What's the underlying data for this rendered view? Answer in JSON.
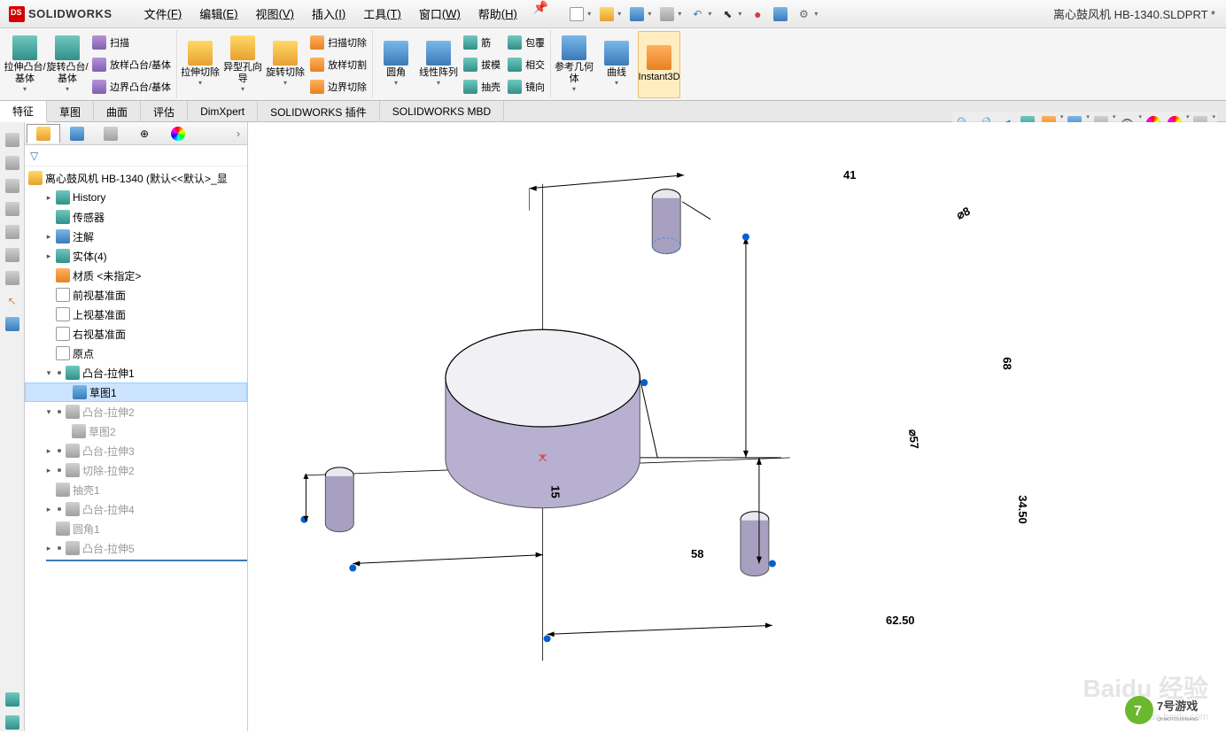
{
  "app": {
    "name": "SOLIDWORKS"
  },
  "document": {
    "title": "离心鼓风机 HB-1340.SLDPRT *"
  },
  "menu": [
    {
      "label": "文件",
      "hotkey": "(F)"
    },
    {
      "label": "编辑",
      "hotkey": "(E)"
    },
    {
      "label": "视图",
      "hotkey": "(V)"
    },
    {
      "label": "插入",
      "hotkey": "(I)"
    },
    {
      "label": "工具",
      "hotkey": "(T)"
    },
    {
      "label": "窗口",
      "hotkey": "(W)"
    },
    {
      "label": "帮助",
      "hotkey": "(H)"
    }
  ],
  "ribbon": {
    "large": [
      {
        "label": "拉伸凸台/基体"
      },
      {
        "label": "旋转凸台/基体"
      }
    ],
    "col1": [
      "扫描",
      "放样凸台/基体",
      "边界凸台/基体"
    ],
    "large2": [
      {
        "label": "拉伸切除"
      },
      {
        "label": "异型孔向导"
      },
      {
        "label": "旋转切除"
      }
    ],
    "col2": [
      "扫描切除",
      "放样切割",
      "边界切除"
    ],
    "large3": [
      {
        "label": "圆角"
      },
      {
        "label": "线性阵列"
      }
    ],
    "col3": [
      "筋",
      "拔模",
      "抽壳"
    ],
    "col4": [
      "包覆",
      "相交",
      "镜向"
    ],
    "large4": [
      {
        "label": "参考几何体"
      },
      {
        "label": "曲线"
      },
      {
        "label": "Instant3D"
      }
    ]
  },
  "tabs": [
    "特征",
    "草图",
    "曲面",
    "评估",
    "DimXpert",
    "SOLIDWORKS 插件",
    "SOLIDWORKS MBD"
  ],
  "tree": {
    "root": "离心鼓风机 HB-1340  (默认<<默认>_显",
    "nodes": [
      {
        "label": "History",
        "color": "ic-teal",
        "i": 1,
        "exp": "▸"
      },
      {
        "label": "传感器",
        "color": "ic-teal",
        "i": 1
      },
      {
        "label": "注解",
        "color": "ic-blue",
        "i": 1,
        "exp": "▸"
      },
      {
        "label": "实体(4)",
        "color": "ic-teal",
        "i": 1,
        "exp": "▸"
      },
      {
        "label": "材质 <未指定>",
        "color": "ic-orange",
        "i": 1
      },
      {
        "label": "前视基准面",
        "color": "ic-white",
        "i": 1
      },
      {
        "label": "上视基准面",
        "color": "ic-white",
        "i": 1
      },
      {
        "label": "右视基准面",
        "color": "ic-white",
        "i": 1
      },
      {
        "label": "原点",
        "color": "ic-white",
        "i": 1
      },
      {
        "label": "凸台-拉伸1",
        "color": "ic-teal",
        "i": 1,
        "exp": "▾",
        "dot": true
      },
      {
        "label": "草图1",
        "color": "ic-blue",
        "i": 2,
        "sel": true
      },
      {
        "label": "凸台-拉伸2",
        "color": "ic-gray",
        "i": 1,
        "exp": "▾",
        "dot": true,
        "sup": true
      },
      {
        "label": "草图2",
        "color": "ic-gray",
        "i": 2,
        "sup": true
      },
      {
        "label": "凸台-拉伸3",
        "color": "ic-gray",
        "i": 1,
        "exp": "▸",
        "dot": true,
        "sup": true
      },
      {
        "label": "切除-拉伸2",
        "color": "ic-gray",
        "i": 1,
        "exp": "▸",
        "dot": true,
        "sup": true
      },
      {
        "label": "抽壳1",
        "color": "ic-gray",
        "i": 1,
        "sup": true
      },
      {
        "label": "凸台-拉伸4",
        "color": "ic-gray",
        "i": 1,
        "exp": "▸",
        "dot": true,
        "sup": true
      },
      {
        "label": "圆角1",
        "color": "ic-gray",
        "i": 1,
        "sup": true
      },
      {
        "label": "凸台-拉伸5",
        "color": "ic-gray",
        "i": 1,
        "exp": "▸",
        "dot": true,
        "sup": true
      }
    ]
  },
  "dimensions": {
    "d41": "41",
    "phi8": "⌀8",
    "d68": "68",
    "phi57": "⌀57",
    "d3450": "34.50",
    "d15": "15",
    "d58": "58",
    "d6250": "62.50"
  },
  "watermark": {
    "big": "Baidu 经验",
    "small": "jingyan.baidu.com",
    "game": "7号游戏",
    "gamesub": "QIHAOYOUXIWANG"
  }
}
